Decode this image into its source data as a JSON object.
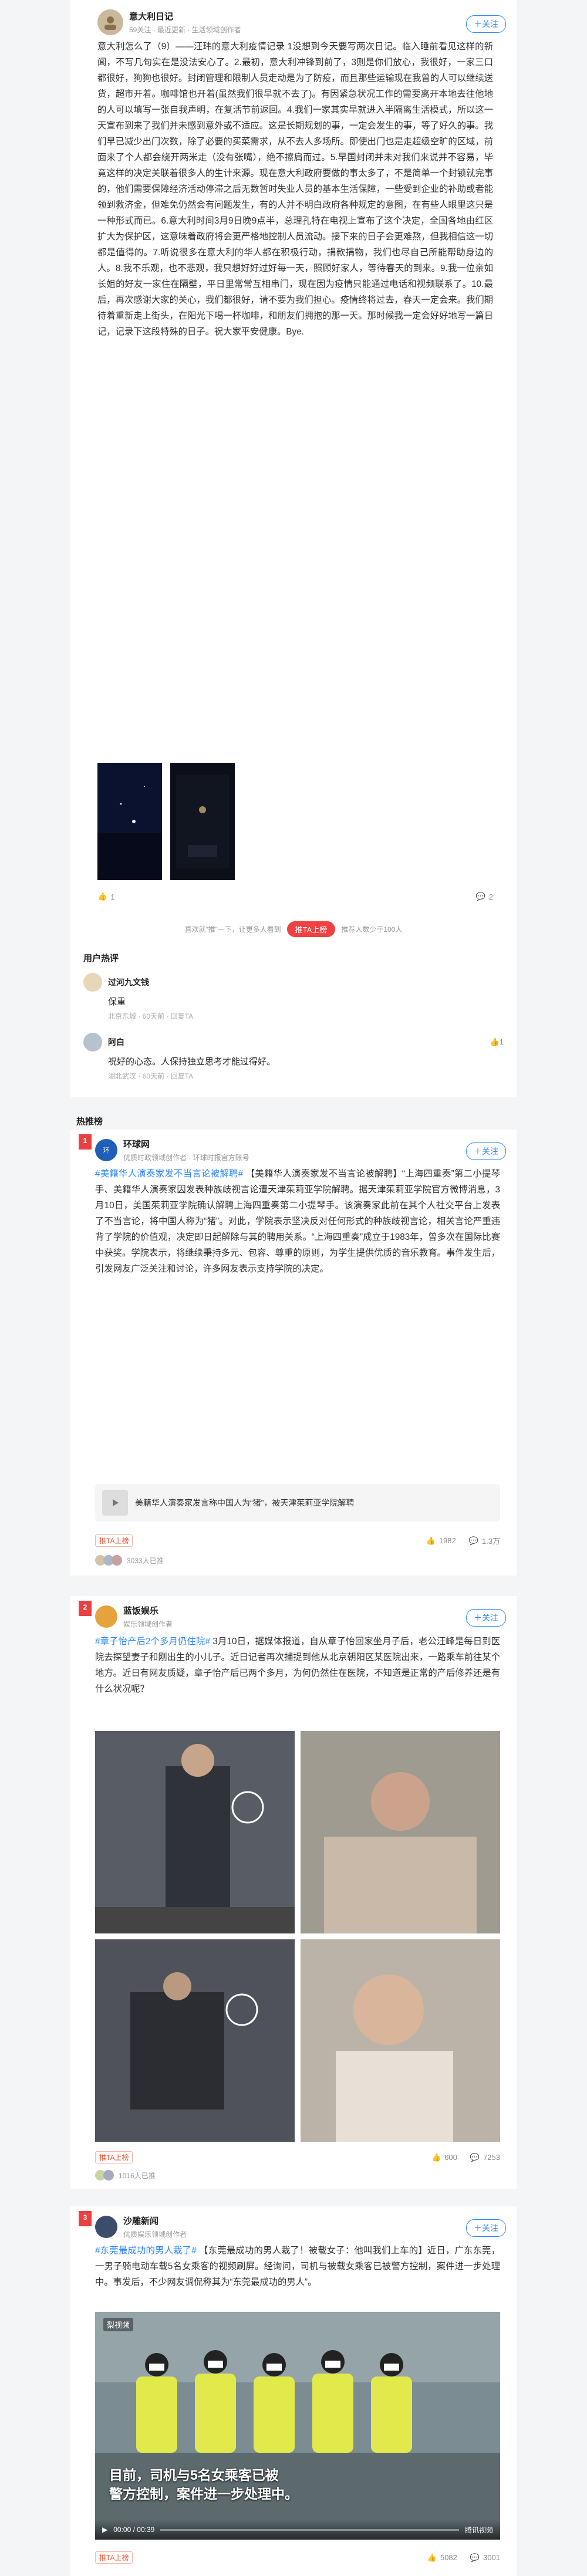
{
  "post": {
    "author_name": "意大利日记",
    "author_meta": "59关注 · 最近更新 · 生活领域创作者",
    "follow_label": "关注",
    "body": "意大利怎么了（9）——汪玮的意大利疫情记录 1没想到今天要写两次日记。临入睡前看见这样的新闻，不写几句实在是没法安心了。2.最初，意大利冲锋到前了，3则是你们放心，我很好，一家三口都很好，狗狗也很好。封闭管理和限制人员走动是为了防疫，而且那些运输现在我曾的人可以继续送货，超市开着。咖啡馆也开着(虽然我们很早就不去了)。有因紧急状况工作的需要离开本地去往他地的人可以填写一张自我声明，在复活节前返回。4.我们一家其实早就进入半隔离生活模式，所以这一天宣布到来了我们并未感到意外或不适应。这是长期规划的事，一定会发生的事，等了好久的事。我们早已减少出门次数，除了必要的买菜需求，从不去人多场所。即使出门也是走超级空旷的区域，前面来了个人都会绕开两米走（没有张嘴），绝不擦肩而过。5.早国封闭并未对我们来说并不容易，毕竟这样的决定关联着很多人的生计来源。现在意大利政府要做的事太多了，不是简单一个封锁就完事的，他们需要保障经济活动停滞之后无数暂时失业人员的基本生活保障，一些受到企业的补助或者能领到救济金，但难免仍然会有问题发生，有的人并不明白政府各种规定的意图，在有些人眼里这只是一种形式而已。6.意大利时间3月9日晚9点半，总理孔特在电视上宣布了这个决定，全国各地由红区扩大为保护区，这意味着政府将会更严格地控制人员流动。接下来的日子会更难熬，但我相信这一切都是值得的。7.听说很多在意大利的华人都在积极行动，捐款捐物，我们也尽自己所能帮助身边的人。8.我不乐观，也不悲观，我只想好好过好每一天，照顾好家人，等待春天的到来。9.我一位亲如长姐的好友一家住在隔壁，平日里常常互相串门，现在因为疫情只能通过电话和视频联系了。10.最后，再次感谢大家的关心，我们都很好，请不要为我们担心。疫情终将过去，春天一定会来。我们期待着重新走上街头，在阳光下喝一杯咖啡，和朋友们拥抱的那一天。那时候我一定会好好地写一篇日记，记录下这段特殊的日子。祝大家平安健康。Bye.",
    "likes": "1",
    "comments": "2",
    "promote_left": "喜欢就“推”一下，让更多人看到",
    "promote_label": "推TA上榜",
    "promote_right": "推荐人数少于100人"
  },
  "comments": {
    "heading": "用户热评",
    "items": [
      {
        "name": "过河九文钱",
        "text": "保重",
        "meta": "北京东城 · 60天前 · 回复TA"
      },
      {
        "name": "阿白",
        "text": "祝好的心态。人保持独立思考才能过得好。",
        "meta": "湖北武汉 · 60天前 · 回复TA",
        "likes": "1"
      }
    ]
  },
  "hot": {
    "heading": "热推榜",
    "items": [
      {
        "rank": "1",
        "source": "环球网",
        "source_meta": "优质时政领域创作者 · 环球时报官方账号",
        "topic": "#美籍华人演奏家发不当言论被解聘# ",
        "text": "【美籍华人演奏家发不当言论被解聘】“上海四重奏”第二小提琴手、美籍华人演奏家因发表种族歧视言论遭天津茱莉亚学院解聘。据天津茱莉亚学院官方微博消息，3月10日，美国茱莉亚学院确认解聘上海四重奏第二小提琴手。该演奏家此前在其个人社交平台上发表了不当言论，将中国人称为“猪”。对此，学院表示坚决反对任何形式的种族歧视言论，相关言论严重违背了学院的价值观，决定即日起解除与其的聘用关系。“上海四重奏”成立于1983年，曾多次在国际比赛中获奖。学院表示，将继续秉持多元、包容、尊重的原则，为学生提供优质的音乐教育。事件发生后，引发网友广泛关注和讨论，许多网友表示支持学院的决定。",
        "linked": "美籍华人演奏家发言称中国人为“猪”，被天津茱莉亚学院解聘",
        "badge": "推TA上榜",
        "likes": "1982",
        "comments": "1.3万",
        "readers": "3033人已推"
      },
      {
        "rank": "2",
        "source": "蓝饭娱乐",
        "source_meta": "娱乐领域创作者",
        "topic": "#章子怡产后2个多月仍住院# ",
        "text": "3月10日，据媒体报道，自从章子怡回家坐月子后，老公汪峰是每日到医院去探望妻子和刚出生的小儿子。近日记者再次捕捉到他从北京朝阳区某医院出来，一路乘车前往某个地方。近日有网友质疑，章子怡产后已两个多月，为何仍然住在医院，不知道是正常的产后修养还是有什么状况呢？",
        "badge": "推TA上榜",
        "likes": "600",
        "comments": "7253",
        "readers": "1016人已推"
      },
      {
        "rank": "3",
        "source": "沙雕新闻",
        "source_meta": "优质娱乐领域创作者",
        "topic": "#东莞最成功的男人栽了# ",
        "text": "【东莞最成功的男人栽了！被载女子：他叫我们上车的】近日，广东东莞，一男子骑电动车载5名女乘客的视频刷屏。经询问，司机与被载女乘客已被警方控制，案件进一步处理中。事发后，不少网友调侃称其为“东莞最成功的男人”。",
        "video_logo": "梨视频",
        "caption1": "目前，司机与5名女乘客已被",
        "caption2": "警方控制，案件进一步处理中。",
        "time": "00:00 / 00:39",
        "player_brand": "腾讯视频",
        "badge": "推TA上榜",
        "likes": "5082",
        "comments": "3001"
      }
    ]
  }
}
